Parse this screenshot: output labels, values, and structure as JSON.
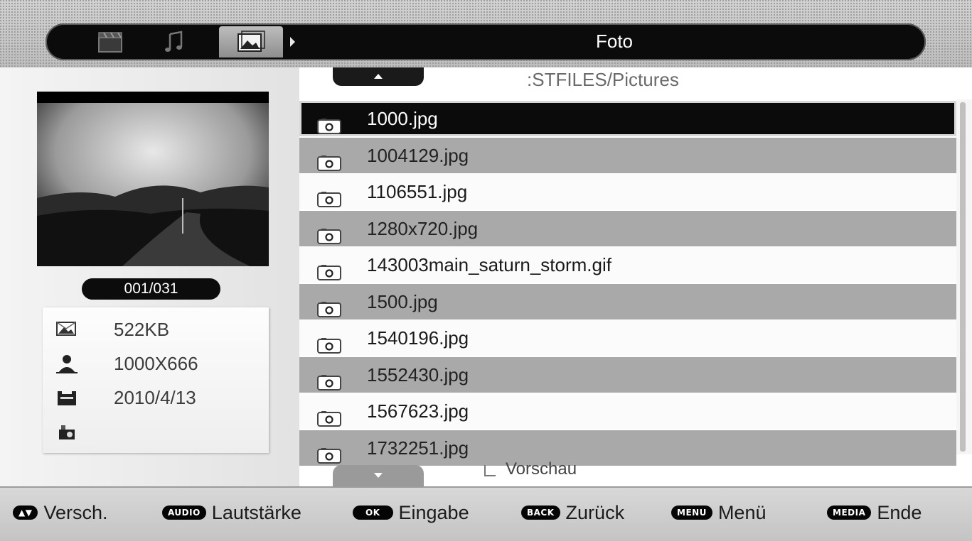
{
  "header": {
    "title": "Foto",
    "categories": [
      {
        "name": "video",
        "icon": "film-clapper-icon"
      },
      {
        "name": "music",
        "icon": "music-note-icon"
      },
      {
        "name": "photo",
        "icon": "photo-icon",
        "active": true
      }
    ]
  },
  "path": ":STFILES/Pictures",
  "counter": "001/031",
  "info": {
    "size": "522KB",
    "resolution": "1000X666",
    "date": "2010/4/13",
    "extra": ""
  },
  "files": [
    {
      "name": "1000.jpg",
      "selected": true
    },
    {
      "name": "1004129.jpg"
    },
    {
      "name": "1106551.jpg"
    },
    {
      "name": "1280x720.jpg"
    },
    {
      "name": "143003main_saturn_storm.gif"
    },
    {
      "name": "1500.jpg"
    },
    {
      "name": "1540196.jpg"
    },
    {
      "name": "1552430.jpg"
    },
    {
      "name": "1567623.jpg"
    },
    {
      "name": "1732251.jpg"
    }
  ],
  "preview_option": "Vorschau",
  "legend": [
    {
      "key": "▲▼",
      "label": "Versch."
    },
    {
      "key": "AUDIO",
      "label": "Lautstärke"
    },
    {
      "key": "OK",
      "label": "Eingabe"
    },
    {
      "key": "BACK",
      "label": "Zurück"
    },
    {
      "key": "MENU",
      "label": "Menü"
    },
    {
      "key": "MEDIA",
      "label": "Ende"
    }
  ],
  "colors": {
    "selected_row": "#0b0b0b",
    "grey_row": "#a9a9a9",
    "white_row": "#fbfbfb",
    "top_bar": "#0b0b0b"
  }
}
